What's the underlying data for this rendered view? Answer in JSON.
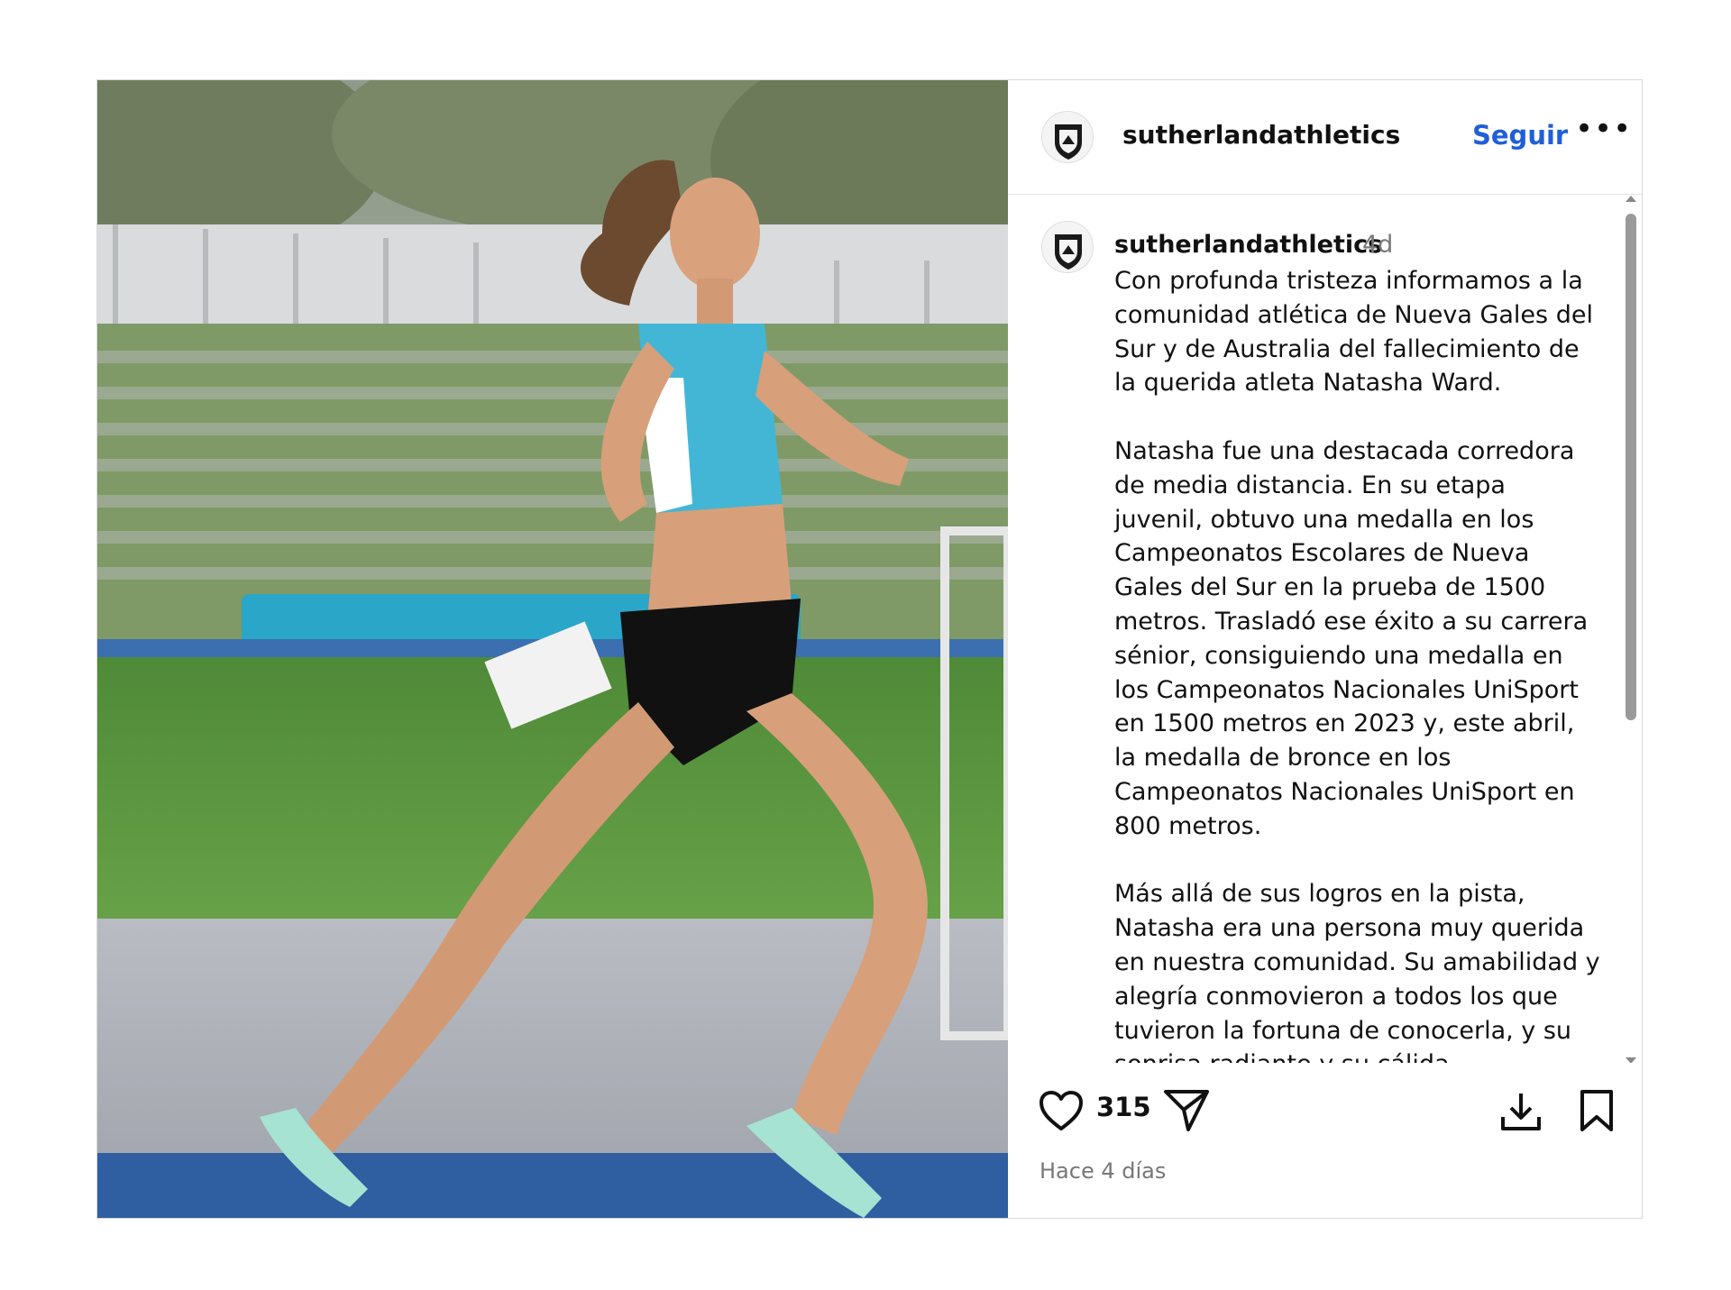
{
  "post": {
    "header": {
      "username": "sutherlandathletics",
      "follow_label": "Seguir",
      "more_label": "•••"
    },
    "caption": {
      "username": "sutherlandathletics",
      "time_ago": "4d",
      "text": "Con profunda tristeza informamos a la comunidad atlética de Nueva Gales del Sur y de Australia del fallecimiento de la querida atleta Natasha Ward.\n\nNatasha fue una destacada corredora de media distancia. En su etapa juvenil, obtuvo una medalla en los Campeonatos Escolares de Nueva Gales del Sur en la prueba de 1500 metros. Trasladó ese éxito a su carrera sénior, consiguiendo una medalla en los Campeonatos Nacionales UniSport en 1500 metros en 2023 y, este abril, la medalla de bronce en los Campeonatos Nacionales UniSport en 800 metros.\n\nMás allá de sus logros en la pista, Natasha era una persona muy querida en nuestra comunidad. Su amabilidad y alegría conmovieron a todos los que tuvieron la fortuna de conocerla, y su sonrisa radiante y su cálida personalidad han dejado una huella imborrable en el"
    },
    "actions": {
      "like_count": "315",
      "date_label": "Hace 4 días"
    },
    "colors": {
      "accent": "#1f5fd8",
      "muted": "#777777",
      "border": "#d8d8d8"
    },
    "icons": [
      "heart-icon",
      "share-icon",
      "download-icon",
      "bookmark-icon",
      "more-icon"
    ]
  }
}
